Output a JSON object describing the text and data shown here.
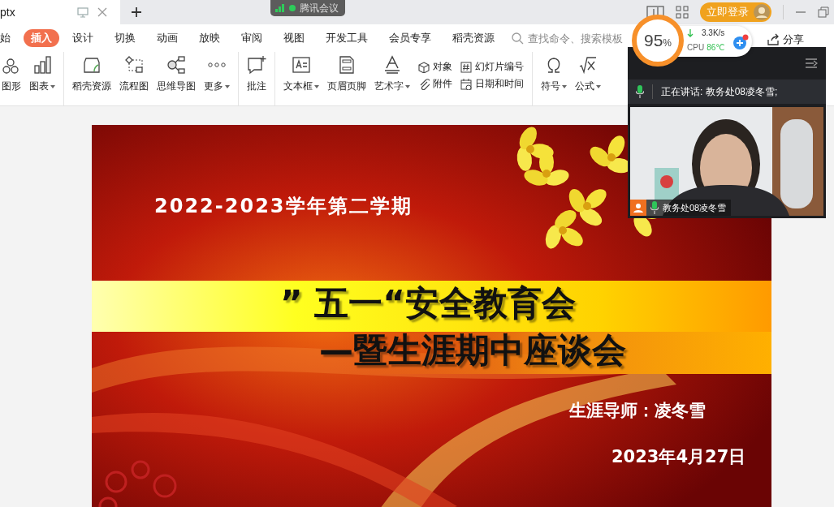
{
  "document_tab": {
    "title": "ptx"
  },
  "meeting_indicator": {
    "label": "腾讯会议"
  },
  "login_button": {
    "label": "立即登录"
  },
  "ribbon_tabs": [
    {
      "label": "始",
      "selected": false
    },
    {
      "label": "插入",
      "selected": true
    },
    {
      "label": "设计",
      "selected": false
    },
    {
      "label": "切换",
      "selected": false
    },
    {
      "label": "动画",
      "selected": false
    },
    {
      "label": "放映",
      "selected": false
    },
    {
      "label": "审阅",
      "selected": false
    },
    {
      "label": "视图",
      "selected": false
    },
    {
      "label": "开发工具",
      "selected": false
    },
    {
      "label": "会员专享",
      "selected": false
    },
    {
      "label": "稻壳资源",
      "selected": false
    }
  ],
  "search": {
    "placeholder": "查找命令、搜索模板"
  },
  "share_button": {
    "label": "分享"
  },
  "tools": [
    {
      "label": "图形",
      "dropdown": false
    },
    {
      "label": "图表",
      "dropdown": true
    },
    {
      "label": "稻壳资源",
      "dropdown": false
    },
    {
      "label": "流程图",
      "dropdown": false
    },
    {
      "label": "思维导图",
      "dropdown": false
    },
    {
      "label": "更多",
      "dropdown": true
    },
    {
      "label": "批注",
      "dropdown": false
    },
    {
      "label": "文本框",
      "dropdown": true
    },
    {
      "label": "页眉页脚",
      "dropdown": false
    },
    {
      "label": "艺术字",
      "dropdown": true
    }
  ],
  "small_tools": [
    {
      "label": "对象"
    },
    {
      "label": "附件"
    },
    {
      "label": "幻灯片编号"
    },
    {
      "label": "日期和时间"
    }
  ],
  "tools_after": [
    {
      "label": "符号",
      "dropdown": true
    },
    {
      "label": "公式",
      "dropdown": true
    }
  ],
  "perf_widget": {
    "usage": "95",
    "unit": "%",
    "speed": "3.3K/s",
    "cpu_label": "CPU",
    "cpu_value": "86℃"
  },
  "meeting_panel": {
    "speaking": "正在讲话: 教务处08凌冬雪;",
    "participant": "教务处08凌冬雪",
    "mic_on": true
  },
  "slide": {
    "term": "2022-2023学年第二学期",
    "title_line1": "” 五一“安全教育会",
    "title_line2": "—暨生涯期中座谈会",
    "mentor": "生涯导师：凌冬雪",
    "date": "2023年4月27日"
  }
}
